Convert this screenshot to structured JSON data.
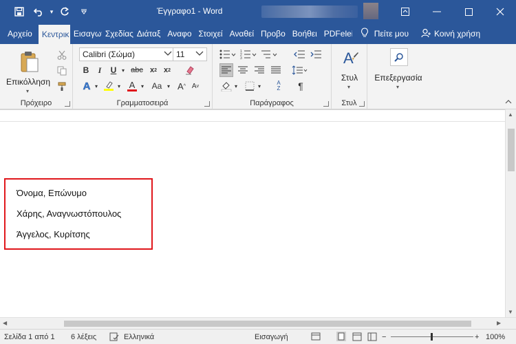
{
  "window": {
    "title": "Έγγραφο1 - Word"
  },
  "tabs": [
    {
      "label": "Αρχείο"
    },
    {
      "label": "Κεντρικ"
    },
    {
      "label": "Εισαγωγ"
    },
    {
      "label": "Σχεδίας"
    },
    {
      "label": "Διάταξ"
    },
    {
      "label": "Αναφο"
    },
    {
      "label": "Στοιχεί"
    },
    {
      "label": "Αναθεί"
    },
    {
      "label": "Προβο"
    },
    {
      "label": "Βοήθει"
    },
    {
      "label": "PDFelei"
    }
  ],
  "tell_me": "Πείτε μου",
  "share": "Κοινή χρήση",
  "ribbon": {
    "paste_label": "Επικόλληση",
    "clipboard_group": "Πρόχειρο",
    "font_name": "Calibri (Σώμα)",
    "font_size": "11",
    "font_group": "Γραμματοσειρά",
    "paragraph_group": "Παράγραφος",
    "styles_label": "Στυλ",
    "styles_group": "Στυλ",
    "editing_label": "Επεξεργασία"
  },
  "document": {
    "lines": [
      "Όνομα, Επώνυμο",
      "Χάρης, Αναγνωστόπουλος",
      "Άγγελος, Κυρίτσης"
    ],
    "highlight_color": "#e0161b"
  },
  "status": {
    "page": "Σελίδα 1 από 1",
    "words": "6 λέξεις",
    "language": "Ελληνικά",
    "mode": "Εισαγωγή",
    "zoom": "100%"
  },
  "colors": {
    "accent": "#2b579a",
    "ribbon_bg": "#f3f3f3"
  }
}
